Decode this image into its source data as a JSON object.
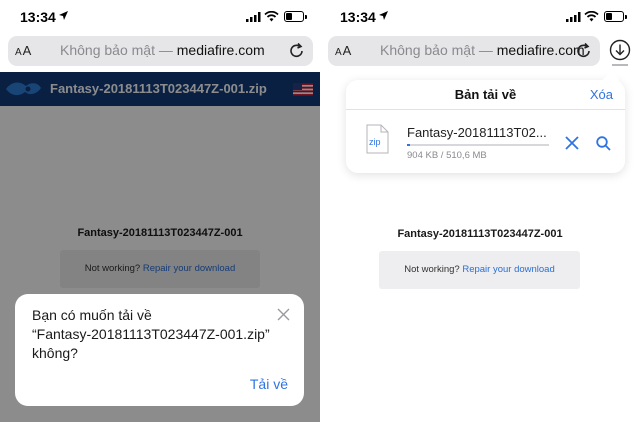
{
  "status": {
    "time": "13:34"
  },
  "left": {
    "url_prefix": "Không bảo mật — ",
    "url_domain": "mediafire.com",
    "text_size_label": "AA",
    "header_filename": "Fantasy-20181113T023447Z-001.zip",
    "file_title": "Fantasy-20181113T023447Z-001",
    "not_working": "Not working?",
    "repair_link": "Repair your download",
    "dialog": {
      "message_line1": "Bạn có muốn tải về",
      "message_line2": "“Fantasy-20181113T023447Z-001.zip”",
      "message_line3": "không?",
      "download_label": "Tải về"
    }
  },
  "right": {
    "url_prefix": "Không bảo mật — ",
    "url_domain": "mediafire.com",
    "text_size_label": "AA",
    "downloads": {
      "title": "Bản tải về",
      "clear_label": "Xóa",
      "file_icon_label": "zip",
      "file_name": "Fantasy-20181113T02...",
      "progress_text": "904 KB / 510,6 MB",
      "progress_fraction": 0.0017
    },
    "file_title": "Fantasy-20181113T023447Z-001",
    "not_working": "Not working?",
    "repair_link": "Repair your download"
  },
  "colors": {
    "accent": "#2f74e0",
    "header_blue": "#123b7b"
  }
}
